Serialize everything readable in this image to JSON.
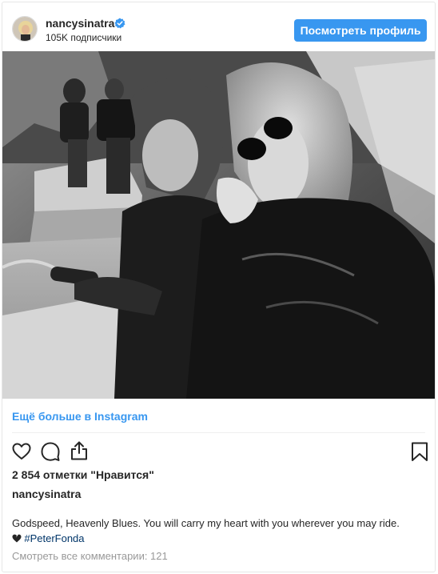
{
  "header": {
    "username": "nancysinatra",
    "followers": "105K подписчики",
    "view_profile_button": "Посмотреть профиль",
    "verified_icon": "verified-badge-icon"
  },
  "post": {
    "photo_description_icon": "photo",
    "more_on_instagram": "Ещё больше в Instagram",
    "likes": "2 854 отметки \"Нравится\"",
    "caption_username": "nancysinatra",
    "caption_text": "Godspeed, Heavenly Blues. You will carry my heart with you wherever you may ride.",
    "caption_emoji": "broken-heart-icon",
    "hashtag": "#PeterFonda",
    "view_comments": "Смотреть все комментарии: 121"
  },
  "colors": {
    "accent": "#3897f0",
    "text": "#262626",
    "muted": "#999999",
    "hashtag": "#003569"
  }
}
